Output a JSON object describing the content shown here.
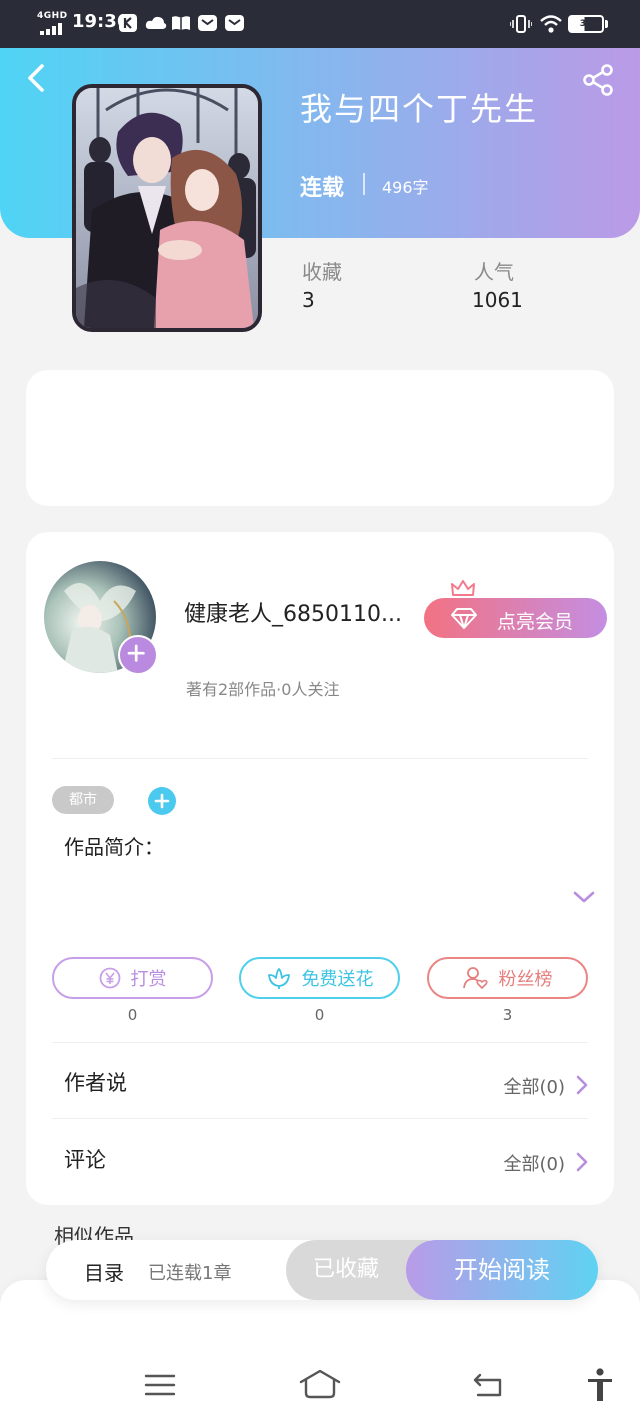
{
  "status_bar": {
    "network": "4GHD",
    "time": "19:36",
    "battery": "39"
  },
  "header": {
    "title": "我与四个丁先生",
    "status": "连载",
    "word_count": "496字"
  },
  "stats": [
    {
      "label": "收藏",
      "value": "3"
    },
    {
      "label": "人气",
      "value": "1061"
    }
  ],
  "author": {
    "name": "健康老人_6850110...",
    "meta": "著有2部作品·0人关注",
    "vip_button": "点亮会员"
  },
  "tags": [
    "都市"
  ],
  "intro_label": "作品简介：",
  "actions": [
    {
      "label": "打赏",
      "count": "0",
      "icon": "yen-circle-icon"
    },
    {
      "label": "免费送花",
      "count": "0",
      "icon": "flower-icon"
    },
    {
      "label": "粉丝榜",
      "count": "3",
      "icon": "fan-heart-icon"
    }
  ],
  "sections": [
    {
      "title": "作者说",
      "link": "全部(0)"
    },
    {
      "title": "评论",
      "link": "全部(0)"
    }
  ],
  "similar_title": "相似作品",
  "bottom_bar": {
    "toc": "目录",
    "progress": "已连载1章",
    "collected": "已收藏",
    "read": "开始阅读"
  },
  "colors": {
    "header_start": "#4fd4f5",
    "header_end": "#bb9ae7",
    "accent_purple": "#b98ee0",
    "accent_cyan": "#4cc9ee",
    "accent_pink": "#e57f7f",
    "vip_start": "#f27282",
    "vip_end": "#c48ee2"
  }
}
